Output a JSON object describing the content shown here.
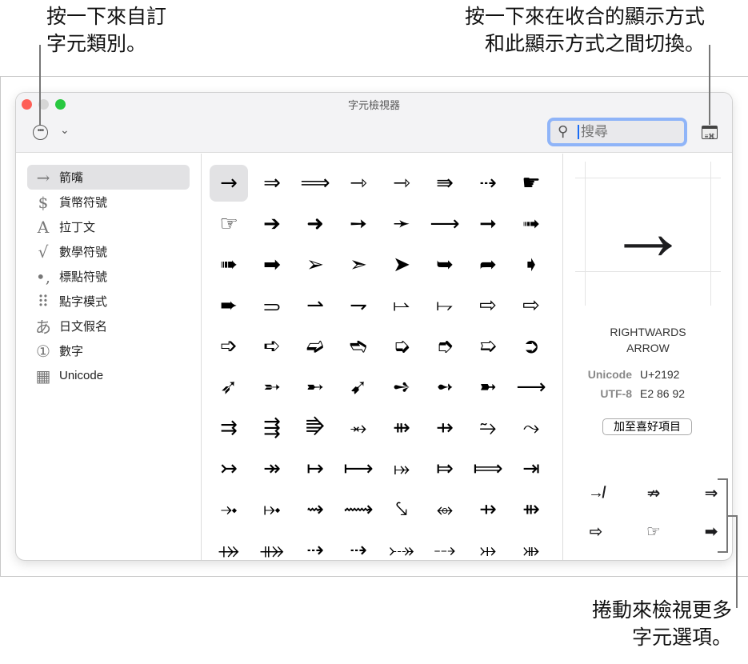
{
  "callouts": {
    "customize": "按一下來自訂\n字元類別。",
    "toggle_view": "按一下來在收合的顯示方式\n和此顯示方式之間切換。",
    "scroll": "捲動來檢視更多\n字元選項。"
  },
  "window": {
    "title": "字元檢視器",
    "more_icon": "ellipsis-circle-icon",
    "chevron": "⌄",
    "search_placeholder": "搜尋",
    "search_icon": "⚲"
  },
  "sidebar": {
    "items": [
      {
        "icon": "→",
        "label": "箭嘴",
        "selected": true
      },
      {
        "icon": "$",
        "label": "貨幣符號"
      },
      {
        "icon": "A",
        "label": "拉丁文"
      },
      {
        "icon": "√",
        "label": "數學符號"
      },
      {
        "icon": "•,",
        "label": "標點符號"
      },
      {
        "icon": "⠿",
        "label": "點字模式"
      },
      {
        "icon": "あ",
        "label": "日文假名"
      },
      {
        "icon": "①",
        "label": "數字"
      },
      {
        "icon": "▦",
        "label": "Unicode"
      }
    ]
  },
  "characters": [
    "→",
    "⇒",
    "⟹",
    "⇾",
    "⇾",
    "⇛",
    "⇢",
    "☛",
    "☞",
    "➔",
    "➜",
    "➙",
    "➛",
    "⟶",
    "➞",
    "➟",
    "➠",
    "➡",
    "➢",
    "➣",
    "➤",
    "➥",
    "➦",
    "➧",
    "➨",
    "⥰",
    "⇀",
    "⇁",
    "⥛",
    "⥟",
    "⇨",
    "⇨",
    "➩",
    "➪",
    "➫",
    "➬",
    "➭",
    "➮",
    "➯",
    "➲",
    "➶",
    "➵",
    "➸",
    "➹",
    "➺",
    "➻",
    "➼",
    "⟶",
    "⇉",
    "⇶",
    "⭆",
    "⥇",
    "⇻",
    "⇸",
    "⥲",
    "⤳",
    "↣",
    "↠",
    "↦",
    "⟼",
    "⤅",
    "⤇",
    "⟾",
    "⇥",
    "⤞",
    "⤠",
    "⇝",
    "⟿",
    "⤥",
    "⥈",
    "⇸",
    "⇻",
    "⤀",
    "⤁",
    "⇢",
    "⇢",
    "⤐",
    "⤏",
    "⤔",
    "⤕"
  ],
  "detail": {
    "char": "→",
    "name": "RIGHTWARDS\nARROW",
    "unicode_label": "Unicode",
    "unicode_value": "U+2192",
    "utf8_label": "UTF-8",
    "utf8_value": "E2 86 92",
    "add_favorite": "加至喜好項目",
    "favorites": [
      "↛",
      "⇏",
      "⇒",
      "⇨",
      "☞",
      "➡",
      "⊙",
      "⬳"
    ]
  }
}
